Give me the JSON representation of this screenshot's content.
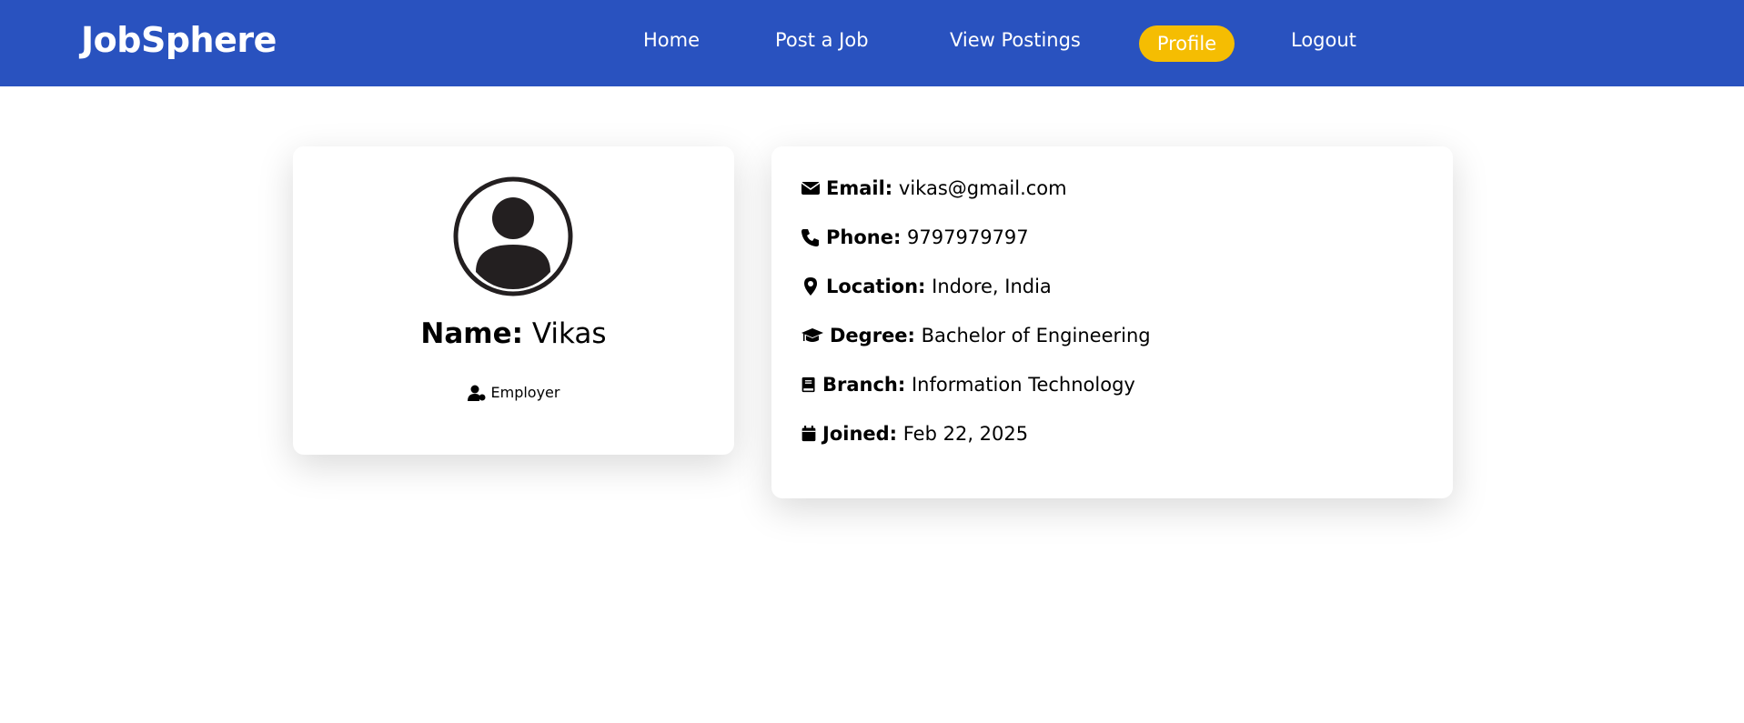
{
  "brand": {
    "logo": "JobSphere",
    "accent": "#2952bf",
    "highlight": "#f5bd02"
  },
  "nav": {
    "items": [
      {
        "label": "Home"
      },
      {
        "label": "Post a Job"
      },
      {
        "label": "View Postings"
      },
      {
        "label": "Profile",
        "active": true
      },
      {
        "label": "Logout"
      }
    ]
  },
  "profile": {
    "name_label": "Name:",
    "name": " Vikas",
    "role": "Employer",
    "avatar_icon": "user-circle-icon"
  },
  "details": [
    {
      "icon": "envelope-icon",
      "label": "Email:",
      "value": "vikas@gmail.com"
    },
    {
      "icon": "phone-icon",
      "label": "Phone:",
      "value": "9797979797"
    },
    {
      "icon": "location-pin-icon",
      "label": "Location:",
      "value": "Indore, India"
    },
    {
      "icon": "graduation-cap-icon",
      "label": "Degree:",
      "value": "Bachelor of Engineering"
    },
    {
      "icon": "book-icon",
      "label": "Branch:",
      "value": "Information Technology"
    },
    {
      "icon": "calendar-icon",
      "label": "Joined:",
      "value": "Feb 22, 2025"
    }
  ]
}
